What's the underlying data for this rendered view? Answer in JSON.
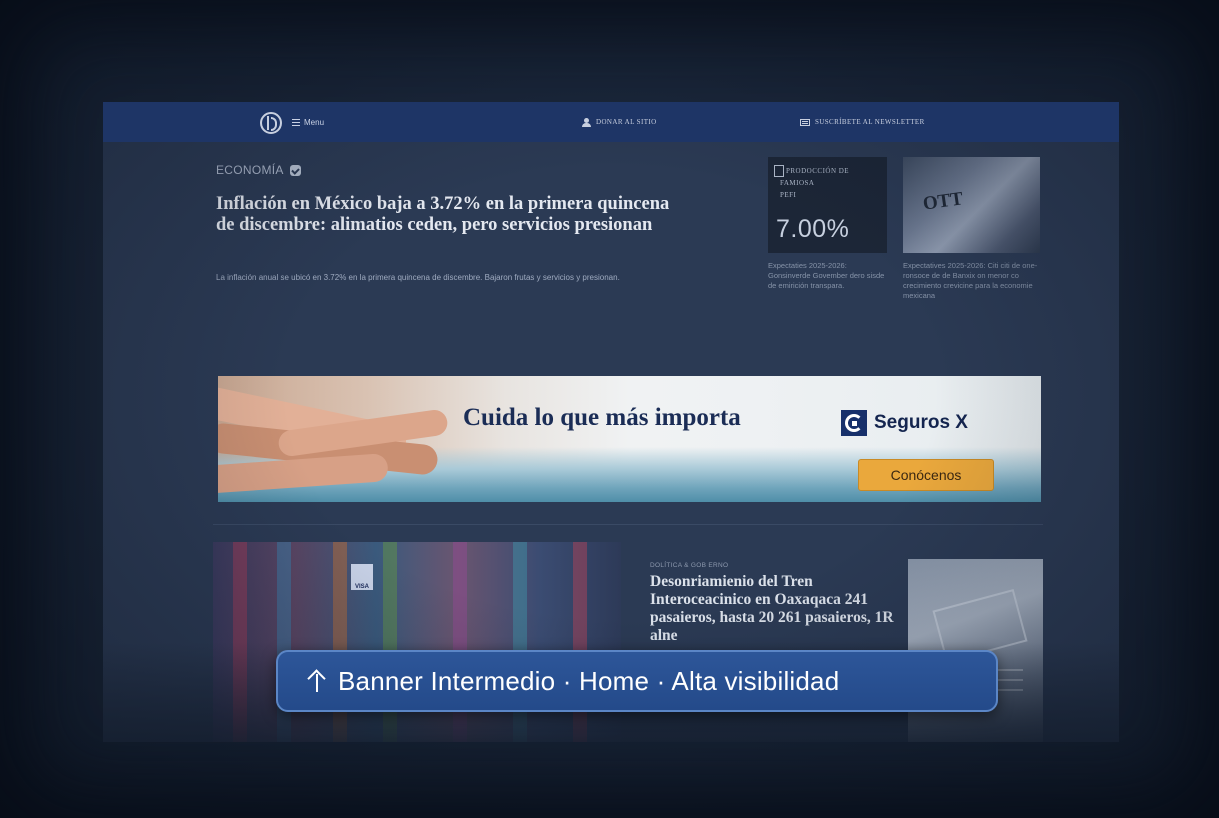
{
  "site": {
    "menu_label": "Menu",
    "donate_label": "DONAR AL SITIO",
    "newsletter_label": "SUSCRÍBETE AL NEWSLETTER"
  },
  "lead": {
    "section": "ECONOMÍA",
    "headline": "Inflación en México baja a 3.72% en la primera quincena de discembre: alimatios ceden, pero servicios presionan",
    "summary": "La inflación anual se ubicó en 3.72% en la primera quincena de discembre. Bajaron frutas y servicios y presionan."
  },
  "side_cards": [
    {
      "thumb_lines": [
        "PRODOCCIÓN DE",
        "FAMIOSA",
        "PEFI"
      ],
      "thumb_value": "7.00%",
      "text": "Expectaties 2025-2026: Gonsinverde Govember dero sisde de emirición transpara."
    },
    {
      "thumb_word": "OTT",
      "text": "Expectatives 2025-2026: Citi citi de one-ronsoce de de Banxix on menor co crecimiento crevicine para la economie mexicana"
    }
  ],
  "ad": {
    "headline": "Cuida lo que más importa",
    "brand": "Seguros X",
    "cta": "Conócenos"
  },
  "story": {
    "image_badge": "VISA",
    "kicker": "DOLÍTICA & GOB ERNO",
    "headline": "Desonriamienio del Tren Interoceacinico en Oaxaqaca 241 pasaieros, hasta 20 261 pasaieros, 1R alne"
  },
  "callout": {
    "arrow_icon": "arrow-up-icon",
    "text": "Banner Intermedio · Home · Alta visibilidad"
  },
  "colors": {
    "topbar": "#1e3566",
    "cta": "#eaa83c",
    "callout": "#2d5699"
  }
}
